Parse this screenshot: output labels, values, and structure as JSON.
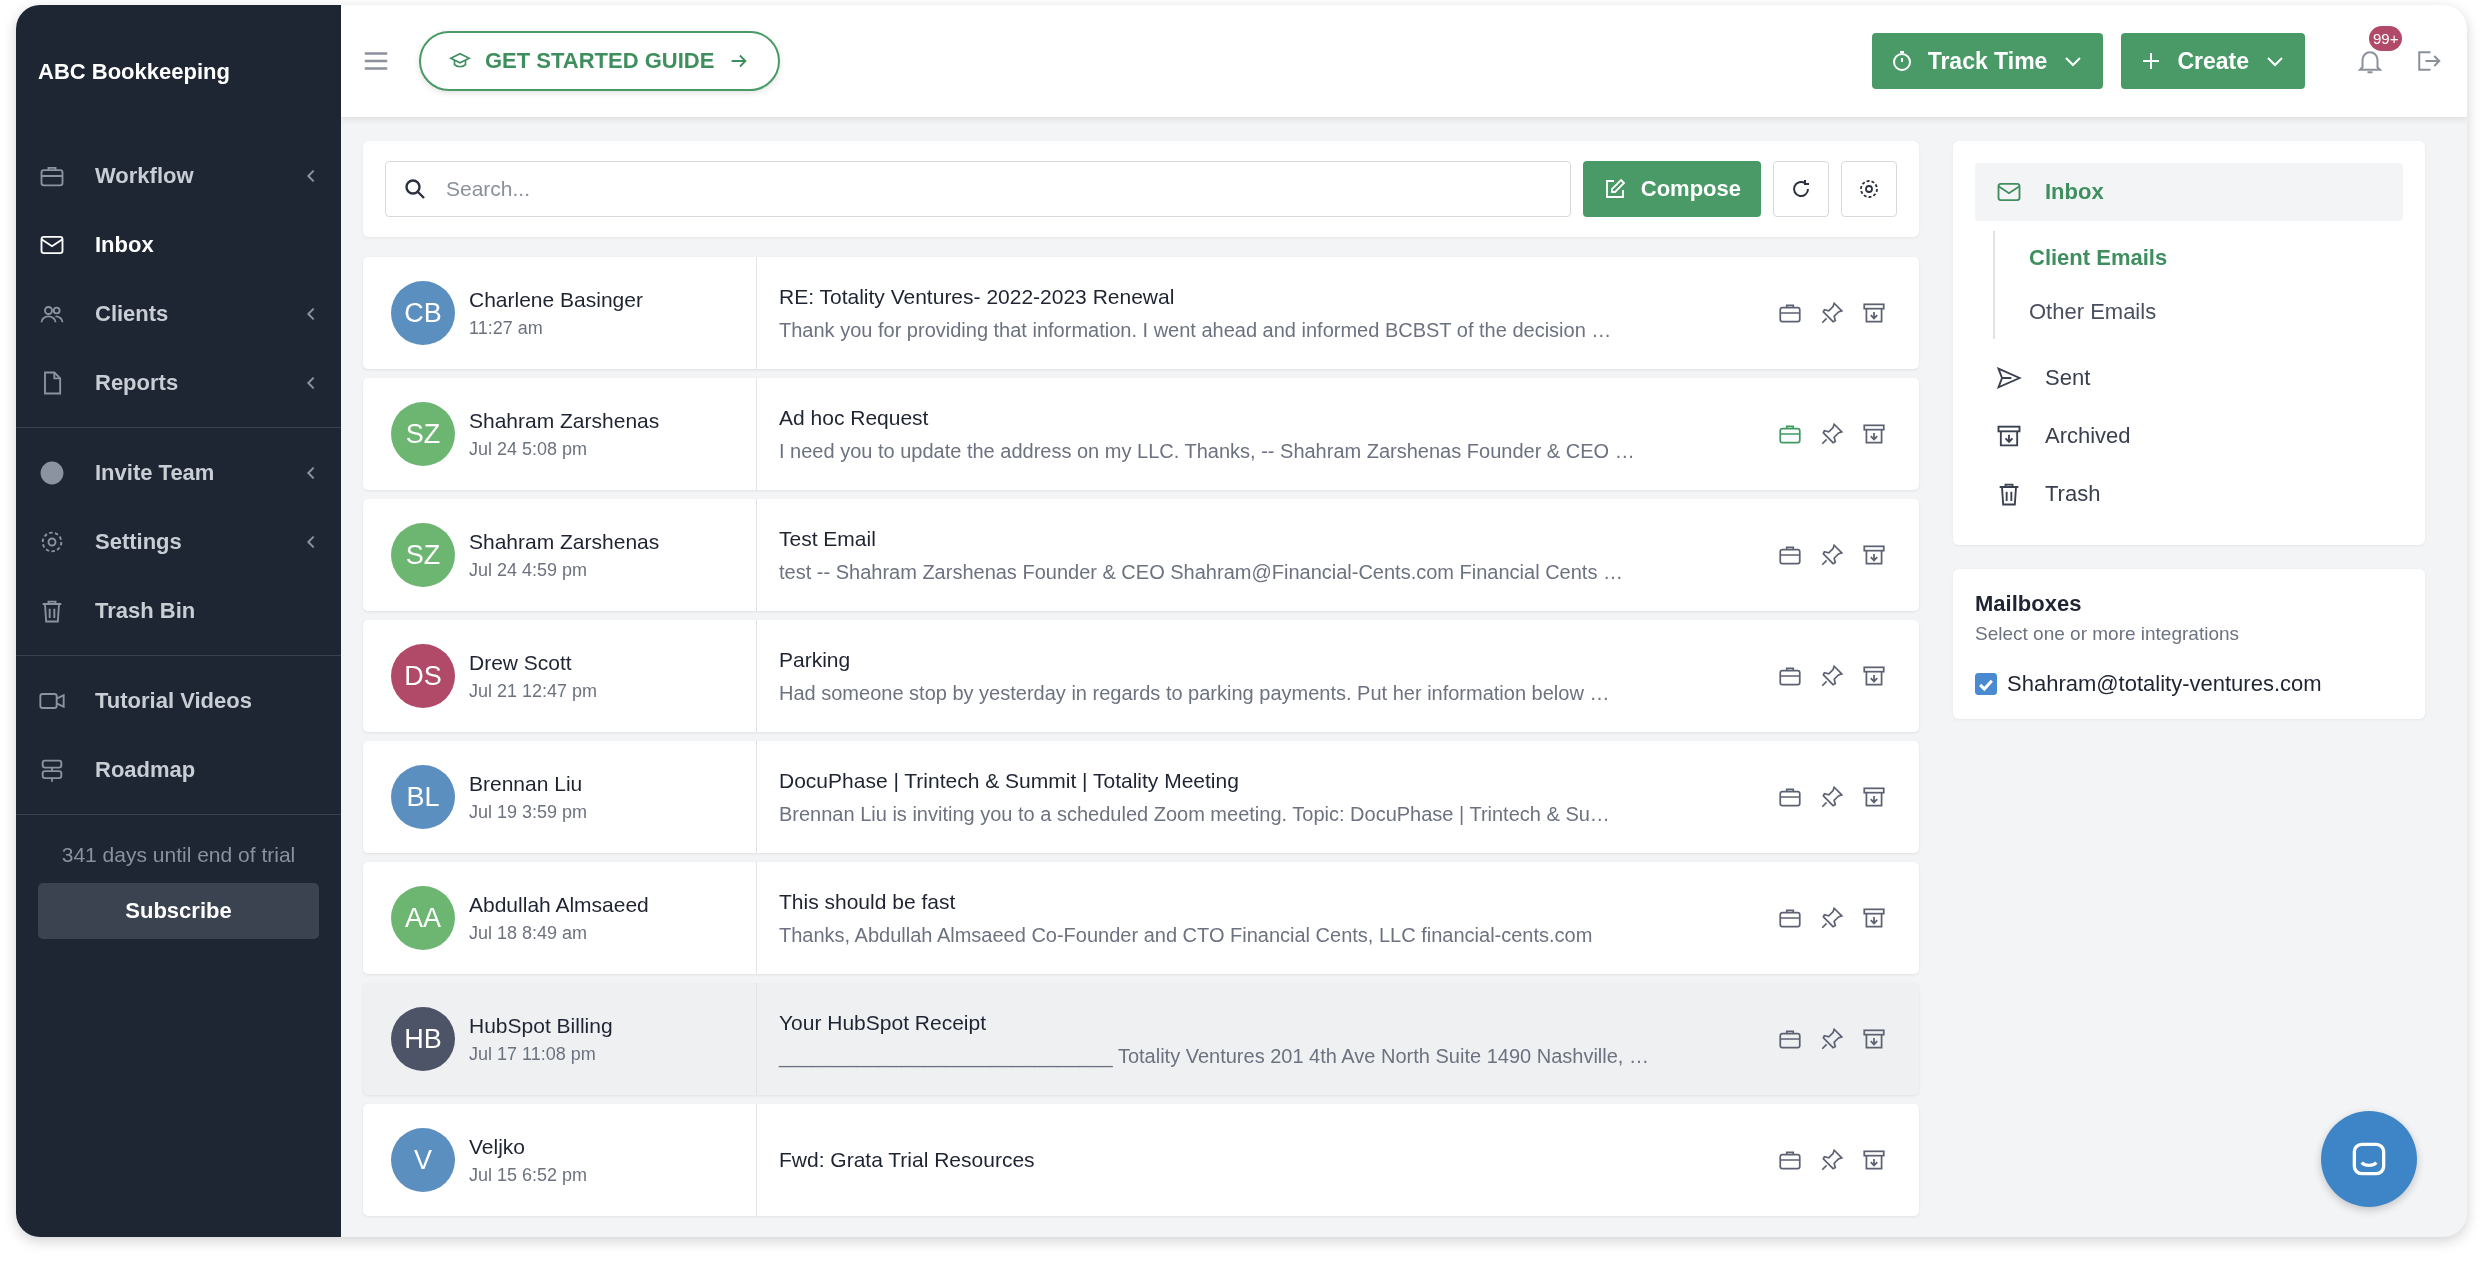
{
  "sidebar": {
    "brand": "ABC Bookkeeping",
    "groups": [
      [
        {
          "label": "Workflow",
          "selected": false,
          "submenu": true
        },
        {
          "label": "Inbox",
          "selected": true,
          "submenu": false
        },
        {
          "label": "Clients",
          "selected": false,
          "submenu": true
        },
        {
          "label": "Reports",
          "selected": false,
          "submenu": true
        }
      ],
      [
        {
          "label": "Invite Team",
          "selected": false,
          "submenu": true
        },
        {
          "label": "Settings",
          "selected": false,
          "submenu": true
        },
        {
          "label": "Trash Bin",
          "selected": false,
          "submenu": false
        }
      ],
      [
        {
          "label": "Tutorial Videos",
          "selected": false,
          "submenu": false
        },
        {
          "label": "Roadmap",
          "selected": false,
          "submenu": false
        }
      ]
    ],
    "trial": "341 days until end of trial",
    "subscribe": "Subscribe"
  },
  "topbar": {
    "guide": "GET STARTED GUIDE",
    "track_time": "Track Time",
    "create": "Create",
    "notifications": "99+"
  },
  "toolbar": {
    "placeholder": "Search...",
    "compose": "Compose"
  },
  "emails": [
    {
      "initials": "CB",
      "color": "#5b8fc0",
      "sender": "Charlene Basinger",
      "date": "11:27 am",
      "subject": "RE: Totality Ventures- 2022-2023 Renewal",
      "preview": "Thank you for providing that information. I went ahead and informed BCBST of the decision …",
      "client_linked": false,
      "hovered": false
    },
    {
      "initials": "SZ",
      "color": "#6db672",
      "sender": "Shahram Zarshenas",
      "date": "Jul 24 5:08 pm",
      "subject": "Ad hoc Request",
      "preview": "I need you to update the address on my LLC. Thanks, -- Shahram Zarshenas Founder & CEO …",
      "client_linked": true,
      "hovered": false
    },
    {
      "initials": "SZ",
      "color": "#6db672",
      "sender": "Shahram Zarshenas",
      "date": "Jul 24 4:59 pm",
      "subject": "Test Email",
      "preview": "test -- Shahram Zarshenas Founder & CEO Shahram@Financial-Cents.com Financial Cents …",
      "client_linked": false,
      "hovered": false
    },
    {
      "initials": "DS",
      "color": "#b04a68",
      "sender": "Drew Scott",
      "date": "Jul 21 12:47 pm",
      "subject": "Parking",
      "preview": "Had someone stop by yesterday in regards to parking payments. Put her information below …",
      "client_linked": false,
      "hovered": false
    },
    {
      "initials": "BL",
      "color": "#5b8fc0",
      "sender": "Brennan Liu",
      "date": "Jul 19 3:59 pm",
      "subject": "DocuPhase | Trintech & Summit | Totality Meeting",
      "preview": "Brennan Liu is inviting you to a scheduled Zoom meeting. Topic: DocuPhase | Trintech & Su…",
      "client_linked": false,
      "hovered": false
    },
    {
      "initials": "AA",
      "color": "#6db672",
      "sender": "Abdullah Almsaeed",
      "date": "Jul 18 8:49 am",
      "subject": "This should be fast",
      "preview": "Thanks, Abdullah Almsaeed Co-Founder and CTO Financial Cents, LLC financial-cents.com",
      "client_linked": false,
      "hovered": false
    },
    {
      "initials": "HB",
      "color": "#4e5468",
      "sender": "HubSpot Billing",
      "date": "Jul 17 11:08 pm",
      "subject": "Your HubSpot Receipt",
      "preview": "______________________________ Totality Ventures 201 4th Ave North Suite 1490 Nashville, …",
      "client_linked": false,
      "hovered": true
    },
    {
      "initials": "V",
      "color": "#5b8fc0",
      "sender": "Veljko",
      "date": "Jul 15 6:52 pm",
      "subject": "Fwd: Grata Trial Resources",
      "client_linked": false,
      "hovered": false
    }
  ],
  "folders": {
    "items": [
      {
        "label": "Inbox",
        "selected": true,
        "children": [
          {
            "label": "Client Emails",
            "selected": true
          },
          {
            "label": "Other Emails",
            "selected": false
          }
        ]
      },
      {
        "label": "Sent",
        "selected": false
      },
      {
        "label": "Archived",
        "selected": false
      },
      {
        "label": "Trash",
        "selected": false
      }
    ]
  },
  "mailboxes": {
    "title": "Mailboxes",
    "subtitle": "Select one or more integrations",
    "accounts": [
      {
        "label": "Shahram@totality-ventures.com",
        "checked": true
      }
    ]
  }
}
